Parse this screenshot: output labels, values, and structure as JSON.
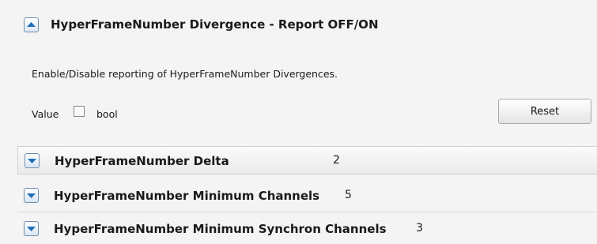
{
  "expanded_section": {
    "title": "HyperFrameNumber Divergence - Report OFF/ON",
    "description": "Enable/Disable reporting of HyperFrameNumber Divergences.",
    "value_label": "Value",
    "value_checked": false,
    "type_label": "bool",
    "reset_label": "Reset"
  },
  "collapsed_sections": [
    {
      "title": "HyperFrameNumber Delta",
      "value": "2"
    },
    {
      "title": "HyperFrameNumber Minimum Channels",
      "value": "5"
    },
    {
      "title": "HyperFrameNumber Minimum Synchron Channels",
      "value": "3"
    }
  ],
  "icons": {
    "collapse": "chevron-up-icon",
    "expand": "chevron-down-icon"
  },
  "colors": {
    "background": "#f4f4f4",
    "icon_arrow": "#1f6fb8"
  }
}
